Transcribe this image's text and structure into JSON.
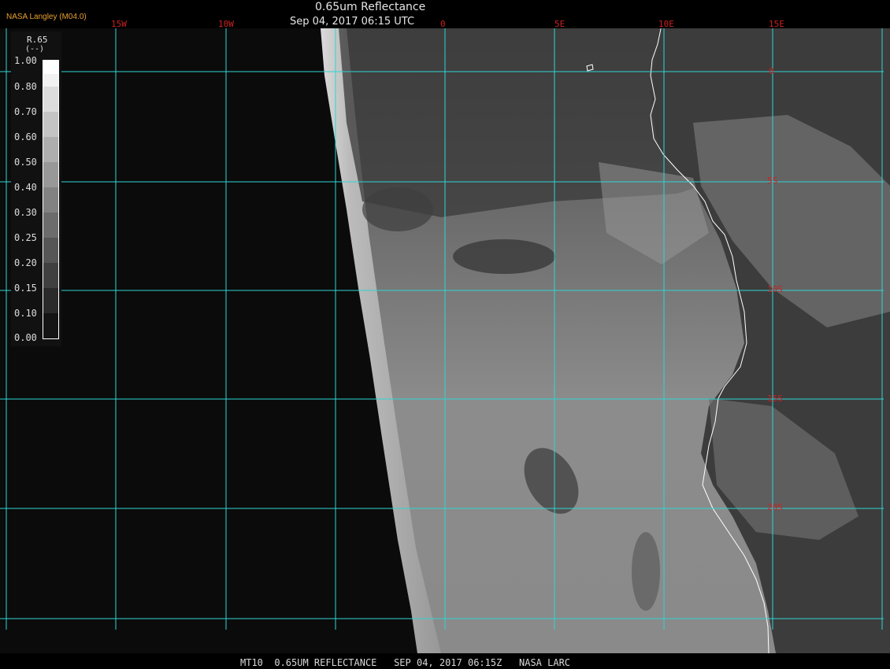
{
  "header": {
    "organization": "NASA Langley (M04.0)",
    "title": "0.65um Reflectance",
    "datetime": "Sep 04, 2017 06:15 UTC"
  },
  "longitude_labels": [
    "15W",
    "10W",
    "0",
    "5E",
    "10E",
    "15E"
  ],
  "latitude_labels": [
    "0",
    "5S",
    "10S",
    "15S",
    "20S"
  ],
  "colorbar": {
    "variable": "R.65",
    "unit": "(--)",
    "ticks": [
      "1.00",
      "0.80",
      "0.70",
      "0.60",
      "0.50",
      "0.40",
      "0.30",
      "0.25",
      "0.20",
      "0.15",
      "0.10",
      "0.00"
    ]
  },
  "footer": "MT10  0.65UM REFLECTANCE   SEP 04, 2017 06:15Z   NASA LARC",
  "colors": {
    "grid": "#2fd4d4",
    "coastline": "#ffffff",
    "labels": "#cc2222",
    "org": "#e8a030"
  }
}
